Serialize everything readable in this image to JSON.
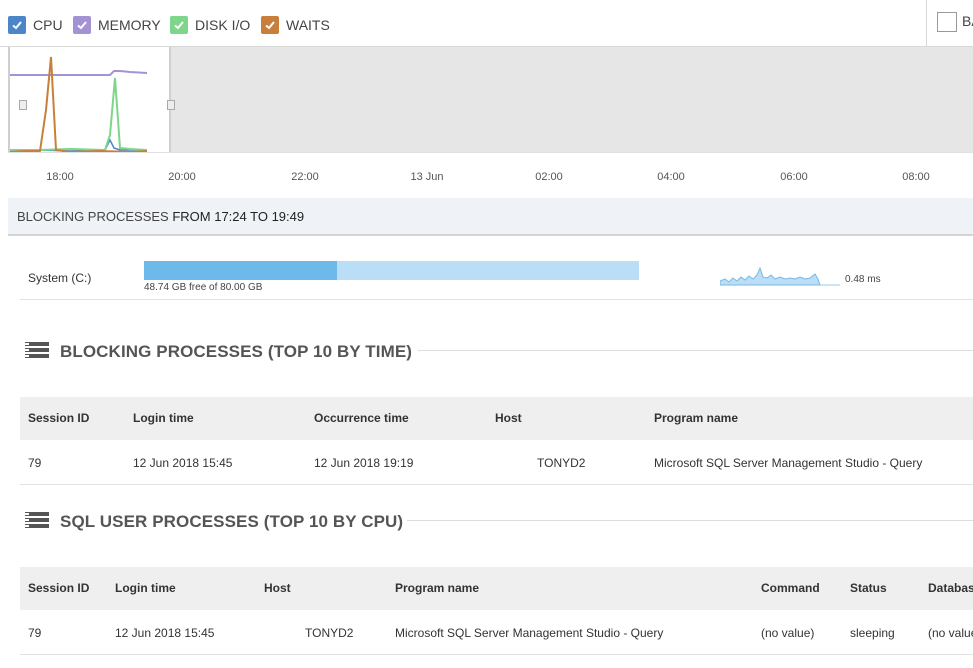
{
  "legend": {
    "items": [
      {
        "label": "CPU",
        "color": "#4a86c8"
      },
      {
        "label": "MEMORY",
        "color": "#a393d4"
      },
      {
        "label": "DISK I/O",
        "color": "#7dd68a"
      },
      {
        "label": "WAITS",
        "color": "#c87f3a"
      }
    ],
    "right_checkbox_label": "BA"
  },
  "timeline": {
    "ticks": [
      "18:00",
      "20:00",
      "22:00",
      "13 Jun",
      "02:00",
      "04:00",
      "06:00",
      "08:00"
    ]
  },
  "blocking_header": {
    "prefix": "BLOCKING PROCESSES",
    "range": "FROM 17:24 TO 19:49"
  },
  "disk": {
    "name": "System (C:)",
    "free_text": "48.74 GB free of 80.00 GB",
    "used_fraction": 0.39,
    "latency": "0.48 ms"
  },
  "blocking_section": {
    "title": "BLOCKING PROCESSES (TOP 10 BY TIME)",
    "columns": [
      "Session ID",
      "Login time",
      "Occurrence time",
      "Host",
      "Program name"
    ],
    "rows": [
      [
        "79",
        "12 Jun 2018 15:45",
        "12 Jun 2018 19:19",
        "TONYD2",
        "Microsoft SQL Server Management Studio - Query"
      ]
    ]
  },
  "sql_section": {
    "title": "SQL USER PROCESSES (TOP 10 BY CPU)",
    "columns": [
      "Session ID",
      "Login time",
      "Host",
      "Program name",
      "Command",
      "Status",
      "Database"
    ],
    "rows": [
      [
        "79",
        "12 Jun 2018 15:45",
        "TONYD2",
        "Microsoft SQL Server Management Studio - Query",
        "(no value)",
        "sleeping",
        "(no value)"
      ]
    ]
  }
}
